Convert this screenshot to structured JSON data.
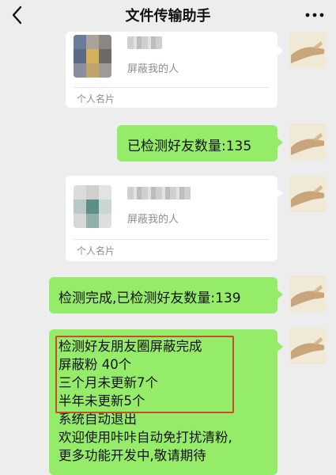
{
  "header": {
    "title": "文件传输助手",
    "back_icon": "chevron-left-icon",
    "more_icon": "more-dots-icon"
  },
  "messages": [
    {
      "type": "contact_card",
      "subtitle": "屏蔽我的人",
      "footer": "个人名片"
    },
    {
      "type": "text",
      "text": "已检测好友数量:135"
    },
    {
      "type": "contact_card",
      "subtitle": "屏蔽我的人",
      "footer": "个人名片"
    },
    {
      "type": "text",
      "text": "检测完成,已检测好友数量:139"
    },
    {
      "type": "text",
      "lines": [
        "检测好友朋友圈屏蔽完成",
        "屏蔽粉 40个",
        "三个月未更新7个",
        "半年未更新5个",
        "系统自动退出",
        "欢迎使用咔咔自动免打扰清粉,",
        "更多功能开发中,敬请期待"
      ]
    }
  ],
  "colors": {
    "background": "#ededed",
    "bubble_self": "#95ec69",
    "card": "#ffffff",
    "highlight_border": "#c84b2a"
  }
}
